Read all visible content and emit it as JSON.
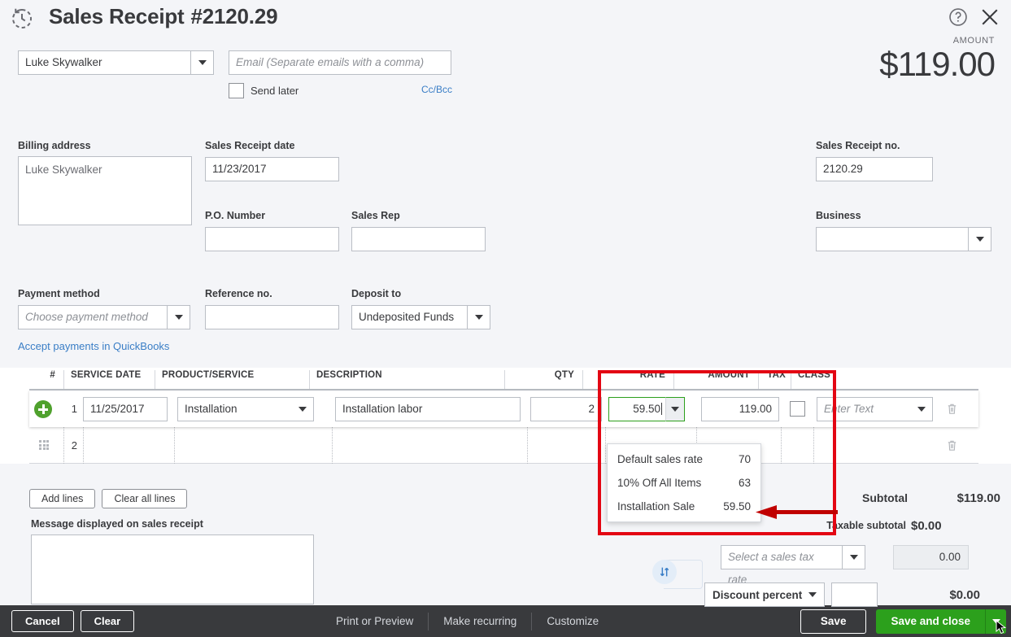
{
  "header": {
    "title": "Sales Receipt",
    "number": "#2120.29",
    "recur_icon": "history-clock-icon",
    "help_icon": "help-circle-icon",
    "close_icon": "close-x-icon",
    "amount_label": "AMOUNT",
    "amount_value": "$119.00"
  },
  "customer": {
    "name": "Luke Skywalker",
    "email_placeholder": "Email (Separate emails with a comma)",
    "email_value": "",
    "send_later_label": "Send later",
    "send_later_checked": false,
    "ccbcc_label": "Cc/Bcc"
  },
  "form": {
    "billing_address_label": "Billing address",
    "billing_address_value": "Luke Skywalker",
    "sales_receipt_date_label": "Sales Receipt date",
    "sales_receipt_date_value": "11/23/2017",
    "po_number_label": "P.O. Number",
    "po_number_value": "",
    "sales_rep_label": "Sales Rep",
    "sales_rep_value": "",
    "sales_receipt_no_label": "Sales Receipt no.",
    "sales_receipt_no_value": "2120.29",
    "business_label": "Business",
    "business_value": "",
    "payment_method_label": "Payment method",
    "payment_method_placeholder": "Choose payment method",
    "reference_no_label": "Reference no.",
    "reference_no_value": "",
    "deposit_to_label": "Deposit to",
    "deposit_to_value": "Undeposited Funds",
    "accept_payments_link": "Accept payments in QuickBooks"
  },
  "table": {
    "columns": [
      "#",
      "SERVICE DATE",
      "PRODUCT/SERVICE",
      "DESCRIPTION",
      "QTY",
      "RATE",
      "AMOUNT",
      "TAX",
      "CLASS"
    ],
    "rows": [
      {
        "num": "1",
        "service_date": "11/25/2017",
        "product_service": "Installation",
        "description": "Installation labor",
        "qty": "2",
        "rate": "59.50",
        "amount": "119.00",
        "tax_checked": false,
        "class_placeholder": "Enter Text",
        "class_value": ""
      },
      {
        "num": "2",
        "service_date": "",
        "product_service": "",
        "description": "",
        "qty": "",
        "rate": "",
        "amount": "",
        "tax_checked": false,
        "class_value": ""
      }
    ],
    "add_lines_label": "Add lines",
    "clear_all_lines_label": "Clear all lines"
  },
  "rate_menu": {
    "open": true,
    "options": [
      {
        "label": "Default sales rate",
        "value": "70"
      },
      {
        "label": "10% Off All Items",
        "value": "63"
      },
      {
        "label": "Installation Sale",
        "value": "59.50"
      }
    ]
  },
  "message": {
    "label": "Message displayed on sales receipt",
    "value": ""
  },
  "totals": {
    "subtotal_label": "Subtotal",
    "subtotal_value": "$119.00",
    "taxable_subtotal_label": "Taxable subtotal",
    "taxable_subtotal_value": "$0.00",
    "tax_rate_placeholder": "Select a sales tax rate",
    "tax_amount_value": "0.00",
    "discount_type_label": "Discount percent",
    "discount_input_value": "",
    "discount_amount_value": "$0.00",
    "swap_icon": "swap-arrows-icon"
  },
  "footer": {
    "cancel_label": "Cancel",
    "clear_label": "Clear",
    "print_preview_label": "Print or Preview",
    "make_recurring_label": "Make recurring",
    "customize_label": "Customize",
    "save_label": "Save",
    "save_and_close_label": "Save and close"
  },
  "annotations": {
    "highlight_color": "#e30613",
    "highlight_target": "rate-column-dropdown",
    "arrow_points_to": "Installation Sale"
  }
}
